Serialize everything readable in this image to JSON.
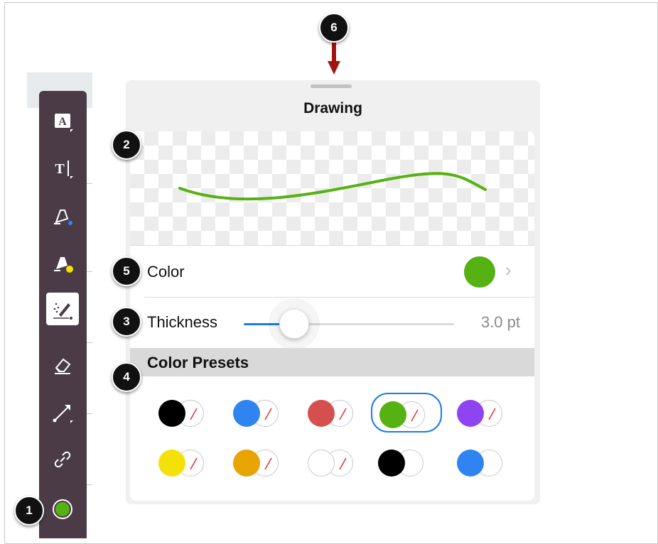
{
  "panel": {
    "title": "Drawing",
    "color_label": "Color",
    "thickness_label": "Thickness",
    "thickness_value": "3.0 pt",
    "thickness_fraction": 0.24,
    "presets_header": "Color Presets",
    "current_color": "#55b212",
    "stroke_color": "#55b212"
  },
  "callouts": [
    "1",
    "2",
    "3",
    "4",
    "5",
    "6"
  ],
  "toolbar": {
    "tools": [
      {
        "name": "text-box-icon",
        "active": false
      },
      {
        "name": "text-icon",
        "active": false
      },
      {
        "name": "pen-icon",
        "active": false
      },
      {
        "name": "highlighter-icon",
        "active": false
      },
      {
        "name": "magic-ink-icon",
        "active": true
      },
      {
        "name": "eraser-icon",
        "active": false
      },
      {
        "name": "line-icon",
        "active": false
      },
      {
        "name": "link-icon",
        "active": false
      }
    ],
    "current_color": "#55b212"
  },
  "presets": [
    {
      "fill": "#000000",
      "background_none": true,
      "selected": false
    },
    {
      "fill": "#2f84f2",
      "background_none": true,
      "selected": false
    },
    {
      "fill": "#d64f4f",
      "background_none": true,
      "selected": false
    },
    {
      "fill": "#55b212",
      "background_none": true,
      "selected": true
    },
    {
      "fill": "#8e44f0",
      "background_none": true,
      "selected": false
    },
    {
      "fill": "#f5e10a",
      "background_none": true,
      "selected": false
    },
    {
      "fill": "#e8a400",
      "background_none": true,
      "selected": false
    },
    {
      "fill": "#ffffff",
      "background_none": true,
      "selected": false
    },
    {
      "fill": "#000000",
      "background_none": false,
      "selected": false
    },
    {
      "fill": "#2f84f2",
      "background_none": false,
      "selected": false
    }
  ]
}
